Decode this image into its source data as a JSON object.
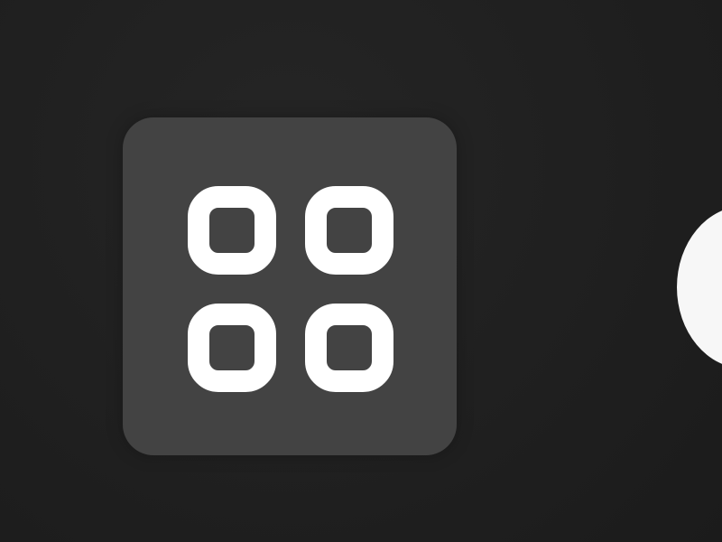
{
  "toolbar": {
    "grid_button": {
      "icon": "grid-view-icon",
      "label": ""
    },
    "next_control": {
      "icon": "partial-circle-control",
      "label": ""
    }
  },
  "colors": {
    "background": "#202020",
    "button_background": "#434343",
    "icon_foreground": "#ffffff",
    "control_foreground": "#f7f7f7"
  }
}
